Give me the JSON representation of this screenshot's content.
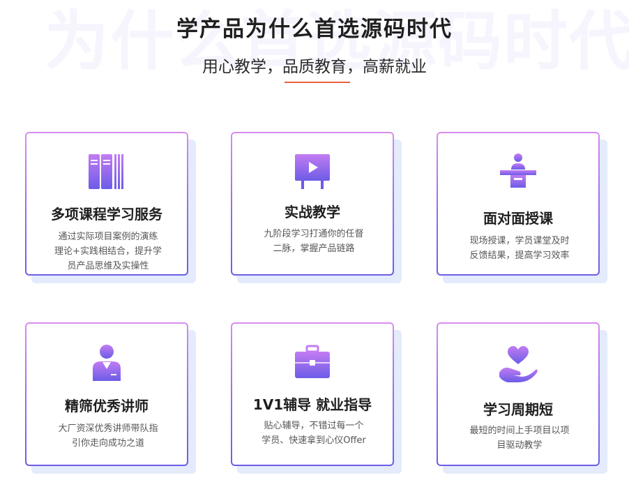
{
  "header": {
    "watermark": "为什么首选源码时代",
    "title": "学产品为什么首选源码时代",
    "subtitle": "用心教学，品质教育，高薪就业"
  },
  "cards": [
    {
      "title": "多项课程学习服务",
      "desc": "通过实际项目案例的演练理论+实践相结合，提升学员产品思维及实操性",
      "icon": "books-icon"
    },
    {
      "title": "实战教学",
      "desc": "九阶段学习打通你的任督二脉，掌握产品链路",
      "icon": "presentation-board-icon"
    },
    {
      "title": "面对面授课",
      "desc": "现场授课，学员课堂及时反馈结果，提高学习效率",
      "icon": "lecturer-podium-icon"
    },
    {
      "title": "精筛优秀讲师",
      "desc": "大厂资深优秀讲师带队指引你走向成功之道",
      "icon": "instructor-person-icon"
    },
    {
      "title": "1V1辅导 就业指导",
      "desc": "贴心辅导，不错过每一个学员、快速拿到心仪Offer",
      "icon": "briefcase-icon"
    },
    {
      "title": "学习周期短",
      "desc": "最短的时间上手项目以项目驱动教学",
      "icon": "heart-hand-icon"
    }
  ],
  "colors": {
    "accent": "#e8623c",
    "icon_top": "#c27cf2",
    "icon_bottom": "#6c5ce7",
    "shadow": "#e3ebfc"
  }
}
